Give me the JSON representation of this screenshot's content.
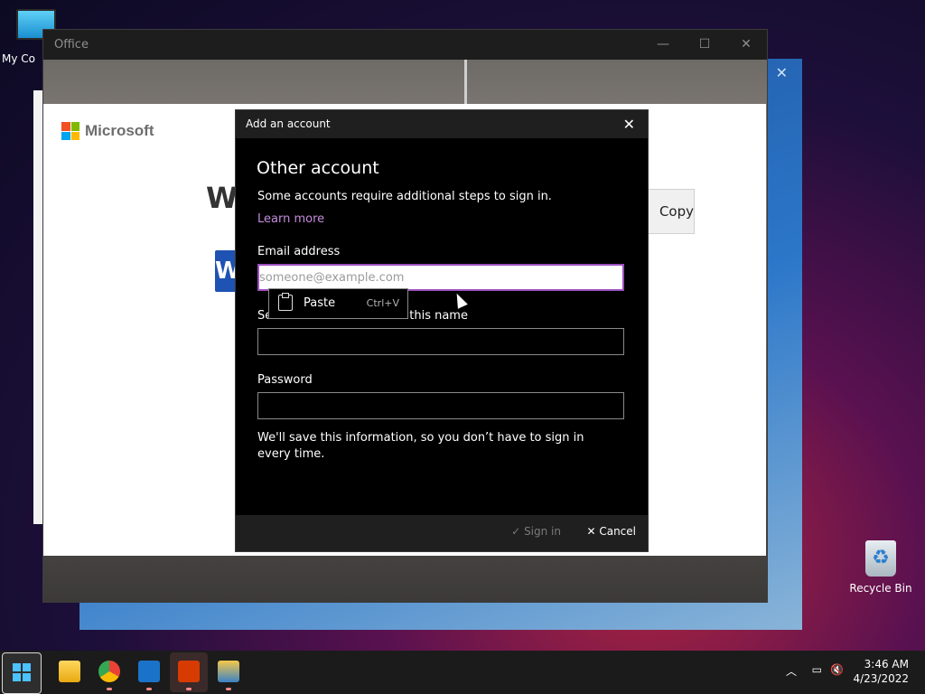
{
  "desktop": {
    "icons": [
      {
        "label": "My Co"
      },
      {
        "label": "Recycle Bin"
      }
    ]
  },
  "office_window": {
    "title": "Office",
    "brand": "Microsoft",
    "welcome_text": "W",
    "word_letter": "W",
    "copy_label": "Copy"
  },
  "dialog": {
    "title": "Add an account",
    "heading": "Other account",
    "description": "Some accounts require additional steps to sign in.",
    "learn_more": "Learn more",
    "email_label": "Email address",
    "email_placeholder": "someone@example.com",
    "name_label_start": "Se",
    "name_label_end": "this name",
    "password_label": "Password",
    "note": "We'll save this information, so you don’t have to sign in every time.",
    "sign_in": "Sign in",
    "cancel": "Cancel"
  },
  "context_menu": {
    "item": "Paste",
    "shortcut": "Ctrl+V"
  },
  "taskbar": {
    "time": "3:46 AM",
    "date": "4/23/2022"
  },
  "colors": {
    "accent": "#9b4fbf",
    "link": "#c58cde",
    "start": "#4cc2ff"
  }
}
